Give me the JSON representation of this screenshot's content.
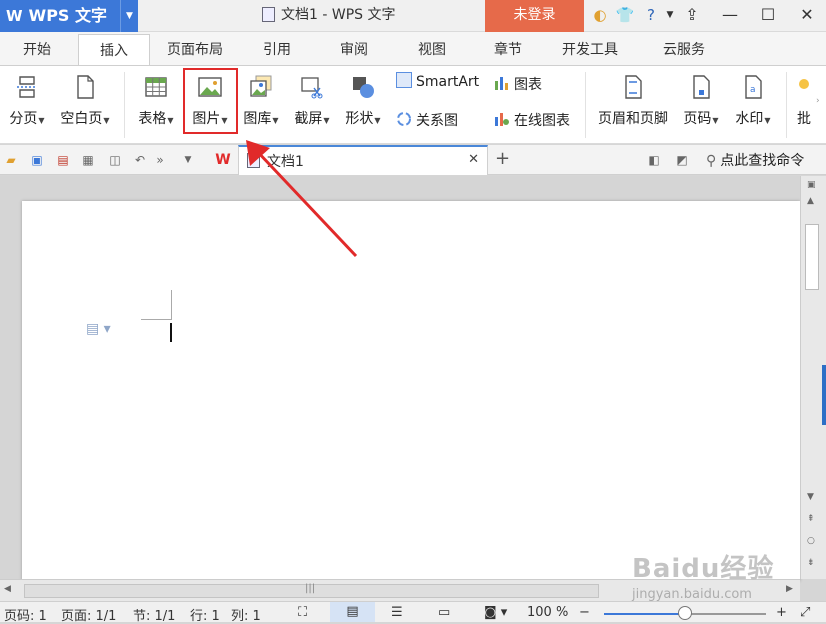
{
  "app": {
    "name": "WPS 文字",
    "logo": "W",
    "window_title": "文档1 - WPS 文字",
    "login_label": "未登录"
  },
  "tabs": [
    {
      "label": "开始"
    },
    {
      "label": "插入",
      "active": true
    },
    {
      "label": "页面布局"
    },
    {
      "label": "引用"
    },
    {
      "label": "审阅"
    },
    {
      "label": "视图"
    },
    {
      "label": "章节"
    },
    {
      "label": "开发工具"
    },
    {
      "label": "云服务"
    }
  ],
  "ribbon": {
    "page_break": "分页",
    "blank_page": "空白页",
    "table": "表格",
    "picture": "图片",
    "gallery": "图库",
    "screenshot": "截屏",
    "shapes": "形状",
    "smartart": "SmartArt",
    "chart": "图表",
    "relation_chart": "关系图",
    "online_chart": "在线图表",
    "header_footer": "页眉和页脚",
    "page_number": "页码",
    "watermark": "水印",
    "comment_partial": "批"
  },
  "quickbar": {
    "doc_tab": "文档1",
    "search_command": "点此查找命令"
  },
  "status": {
    "page_num": "页码: 1",
    "page": "页面: 1/1",
    "section": "节: 1/1",
    "row": "行: 1",
    "col": "列: 1",
    "zoom": "100 %",
    "zoom_level": 0.5
  },
  "watermark": {
    "logo": "Baidu经验",
    "url": "jingyan.baidu.com"
  },
  "colors": {
    "accent": "#3c78d8",
    "login": "#e66a4a",
    "highlight": "#e12a2a"
  }
}
